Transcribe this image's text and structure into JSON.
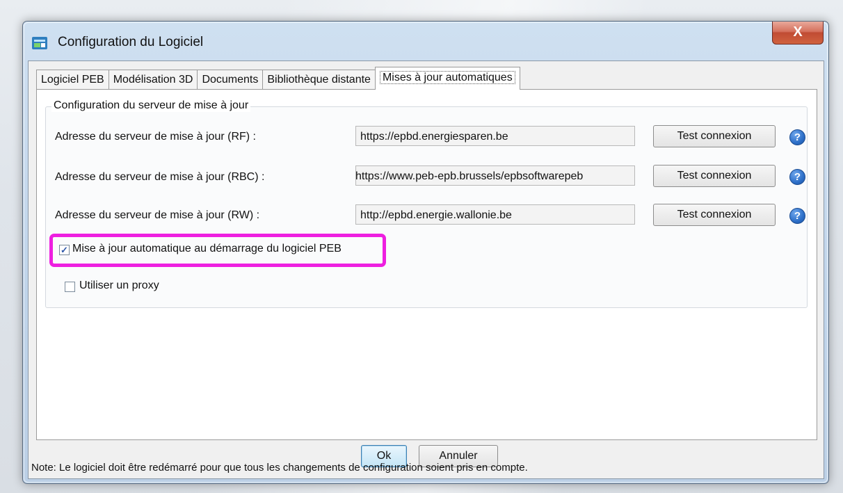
{
  "window": {
    "title": "Configuration du Logiciel",
    "close_label": "X"
  },
  "tabs": [
    {
      "label": "Logiciel PEB",
      "active": false
    },
    {
      "label": "Modélisation 3D",
      "active": false
    },
    {
      "label": "Documents",
      "active": false
    },
    {
      "label": "Bibliothèque distante",
      "active": false
    },
    {
      "label": "Mises à jour automatiques",
      "active": true
    }
  ],
  "group": {
    "legend": "Configuration du serveur de mise à jour",
    "rows": [
      {
        "label": "Adresse du serveur de mise à jour (RF) :",
        "value": "https://epbd.energiesparen.be",
        "button": "Test connexion",
        "help": "?"
      },
      {
        "label": "Adresse du serveur de mise à jour (RBC) :",
        "value": "https://www.peb-epb.brussels/epbsoftwarepeb",
        "button": "Test connexion",
        "help": "?"
      },
      {
        "label": "Adresse du serveur de mise à jour (RW) :",
        "value": "http://epbd.energie.wallonie.be",
        "button": "Test connexion",
        "help": "?"
      }
    ],
    "auto_update": {
      "label": "Mise à jour automatique au démarrage du logiciel PEB",
      "checked": true,
      "mark": "✓"
    },
    "use_proxy": {
      "label": "Utiliser un proxy",
      "checked": false
    }
  },
  "buttons": {
    "ok": "Ok",
    "cancel": "Annuler"
  },
  "note": "Note: Le logiciel doit être redémarré pour que tous les changements de configuration soient pris en compte.",
  "colors": {
    "highlight": "#ee1fe0",
    "help": "#2d6fc8"
  }
}
